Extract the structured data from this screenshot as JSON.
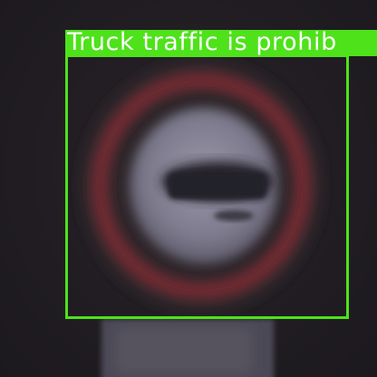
{
  "detection": {
    "label": "Truck traffic is prohib",
    "box_color": "#4ee21a",
    "label_text_color": "#ffffff"
  },
  "scene": {
    "subject": "circular-no-trucks-road-sign"
  }
}
